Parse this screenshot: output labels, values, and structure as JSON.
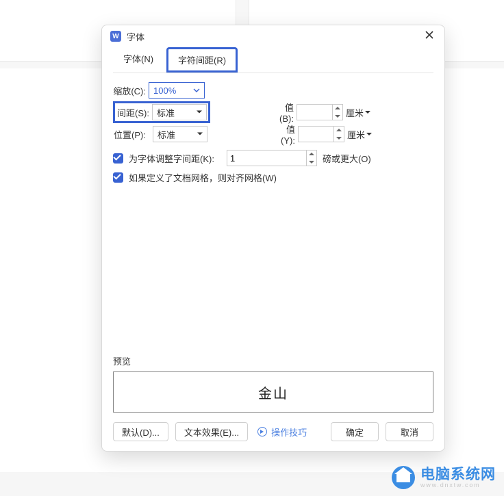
{
  "window": {
    "app_letter": "W",
    "title": "字体"
  },
  "tabs": {
    "font": "字体(N)",
    "spacing": "字符间距(R)"
  },
  "fields": {
    "scale": {
      "label": "缩放(C):",
      "value": "100%"
    },
    "spacing": {
      "label": "间距(S):",
      "value": "标准"
    },
    "spacing_val": {
      "label": "值(B):",
      "value": "",
      "unit": "厘米"
    },
    "position": {
      "label": "位置(P):",
      "value": "标准"
    },
    "position_val": {
      "label": "值(Y):",
      "value": "",
      "unit": "厘米"
    }
  },
  "checks": {
    "kerning": {
      "label": "为字体调整字间距(K):",
      "value": "1",
      "unit": "磅或更大(O)"
    },
    "grid": {
      "label": "如果定义了文档网格，则对齐网格(W)"
    }
  },
  "preview": {
    "label": "预览",
    "sample": "金山"
  },
  "footer": {
    "default": "默认(D)...",
    "text_effects": "文本效果(E)...",
    "tips": "操作技巧",
    "ok": "确定",
    "cancel": "取消"
  },
  "watermark": {
    "cn": "电脑系统网",
    "en": "www.dnxtw.com"
  }
}
